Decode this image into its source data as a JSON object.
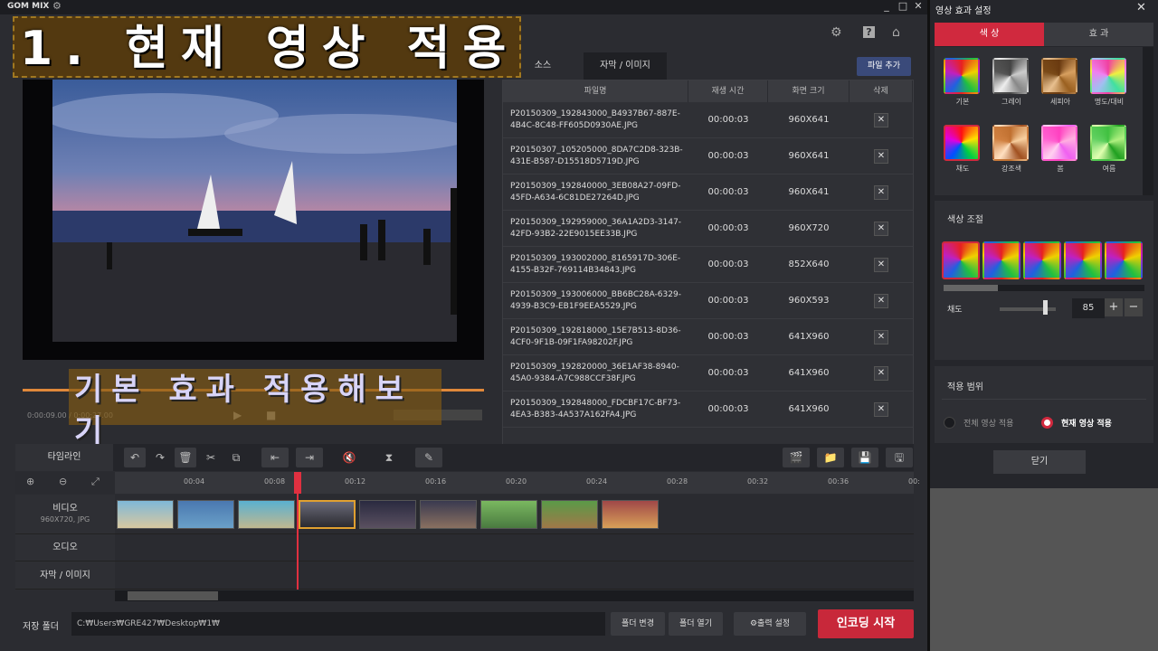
{
  "app": {
    "logo": "GOM MIX"
  },
  "overlay": {
    "title": "1. 현재 영상 적용",
    "subtitle": "기본 효과 적용해보기"
  },
  "preview": {
    "time": "0:00:09.00 / 0:00:27.00"
  },
  "source_panel": {
    "tabs": [
      "소스",
      "자막 / 이미지"
    ],
    "add_file_label": "파일 추가",
    "columns": [
      "파일명",
      "재생 시간",
      "화면 크기",
      "삭제"
    ],
    "rows": [
      {
        "name": "P20150309_192843000_B4937B67-887E-4B4C-8C48-FF605D0930AE.JPG",
        "duration": "00:00:03",
        "size": "960X641"
      },
      {
        "name": "P20150307_105205000_8DA7C2D8-323B-431E-B587-D15518D5719D.JPG",
        "duration": "00:00:03",
        "size": "960X641"
      },
      {
        "name": "P20150309_192840000_3EB08A27-09FD-45FD-A634-6C81DE27264D.JPG",
        "duration": "00:00:03",
        "size": "960X641"
      },
      {
        "name": "P20150309_192959000_36A1A2D3-3147-42FD-93B2-22E9015EE33B.JPG",
        "duration": "00:00:03",
        "size": "960X720"
      },
      {
        "name": "P20150309_193002000_8165917D-306E-4155-B32F-769114B34843.JPG",
        "duration": "00:00:03",
        "size": "852X640"
      },
      {
        "name": "P20150309_193006000_BB6BC28A-6329-4939-B3C9-EB1F9EEA5529.JPG",
        "duration": "00:00:03",
        "size": "960X593"
      },
      {
        "name": "P20150309_192818000_15E7B513-8D36-4CF0-9F1B-09F1FA98202F.JPG",
        "duration": "00:00:03",
        "size": "641X960"
      },
      {
        "name": "P20150309_192820000_36E1AF38-8940-45A0-9384-A7C988CCF38F.JPG",
        "duration": "00:00:03",
        "size": "641X960"
      },
      {
        "name": "P20150309_192848000_FDCBF17C-BF73-4EA3-B383-4A537A162FA4.JPG",
        "duration": "00:00:03",
        "size": "641X960"
      }
    ]
  },
  "timeline": {
    "label": "타임라인",
    "ticks": [
      "00:04",
      "00:08",
      "00:12",
      "00:16",
      "00:20",
      "00:24",
      "00:28",
      "00:32",
      "00:36",
      "00:"
    ],
    "tracks": {
      "video": "비디오",
      "video_info": "960X720, JPG",
      "audio": "오디오",
      "subtitle": "자막 / 이미지"
    }
  },
  "bottom": {
    "save_label": "저장 폴더",
    "path": "C:₩Users₩GRE427₩Desktop₩1₩",
    "change_folder": "폴더 변경",
    "open_folder": "폴더 열기",
    "output_settings": "출력 설정",
    "encode": "인코딩 시작"
  },
  "fx_panel": {
    "title": "영상 효과 설정",
    "tabs": [
      "색 상",
      "효 과"
    ],
    "presets": [
      "기본",
      "그레이",
      "세피아",
      "명도/대비",
      "채도",
      "강조색",
      "봄",
      "여름"
    ],
    "adjust_title": "색상 조절",
    "saturation_label": "채도",
    "saturation_value": "85",
    "range_title": "적용 범위",
    "range_all": "전체 영상 적용",
    "range_current": "현재 영상 적용",
    "close_label": "닫기",
    "accent": "#d0293e"
  }
}
